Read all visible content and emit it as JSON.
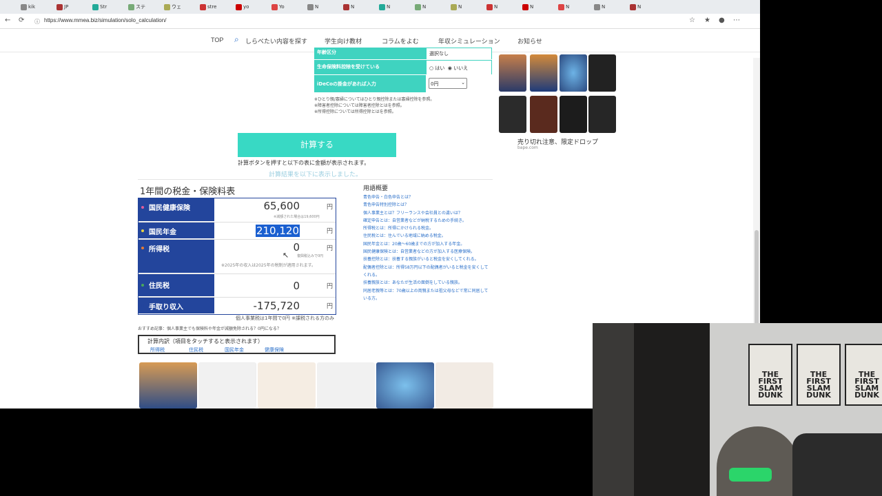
{
  "browser": {
    "url": "https://www.mmea.biz/simulation/solo_calculation/",
    "tabs": [
      "kik",
      "JP",
      "Str",
      "ステ",
      "ウェ",
      "stre",
      "yo",
      "Yo",
      "N",
      "N",
      "N",
      "N",
      "N",
      "N",
      "N",
      "N",
      "N",
      "N"
    ]
  },
  "site_nav": {
    "items": [
      "TOP",
      "しらべたい内容を探す",
      "学生向け教材",
      "コラムをよむ",
      "年収シミュレーション",
      "お知らせ"
    ]
  },
  "form": {
    "partial_row_label": "年齢区分",
    "partial_row_value": "選択なし",
    "life_insurance_label": "生命保険料控除を受けている",
    "radio_yes": "はい",
    "radio_no": "いいえ",
    "ideco_label": "iDeCoの掛金があれば入力",
    "ideco_value": "0円",
    "notes": [
      "※ひとり親/寡婦についてはひとり親控除または寡婦控除を参照。",
      "※障害者控除については障害者控除とはを参照。",
      "※所得控除については所得控除とはを参照。"
    ]
  },
  "calc": {
    "button_label": "計算する",
    "note": "計算ボタンを押すと以下の表に金額が表示されます。",
    "result_note": "計算結果を以下に表示しました。"
  },
  "results": {
    "heading": "1年間の税金・保険料表",
    "yen": "円",
    "rows": [
      {
        "label": "国民健康保険",
        "value": "65,600",
        "sub": "※減額された場合は19,600円"
      },
      {
        "label": "国民年金",
        "value": "210,120"
      },
      {
        "label": "所得税",
        "value": "0",
        "sub": "復興税込みで0円",
        "sub2": "※2025年の収入は2025年の税制が適用されます。"
      },
      {
        "label": "住民税",
        "value": "0"
      },
      {
        "label": "手取り収入",
        "value": "-175,720"
      }
    ],
    "below": "個人事業税は1年間で0円 ※課税される方のみ",
    "recommend": "おすすめ記事：個人事業主でも保険料や年金が減額免除される？0円になる？"
  },
  "breakdown": {
    "title": "計算内訳（項目をタッチすると表示されます）",
    "links": [
      "所得税",
      "住民税",
      "国民年金",
      "健康保険"
    ]
  },
  "glossary": {
    "title": "用語概要",
    "items": [
      "青色申告・白色申告とは？",
      "青色申告特別控除とは？",
      "個人事業主とは？フリーランスや会社員との違いは？",
      "確定申告とは：自営業者などが納税するための手続き。",
      "所得税とは：所得にかけられる税金。",
      "住民税とは：住んでいる地域に納める税金。",
      "国民年金とは：20歳〜60歳までの方が加入する年金。",
      "国民健康保険とは：自営業者などの方が加入する医療保険。",
      "扶養控除とは：扶養する親族がいると税金を安くしてくれる。",
      "配偶者控除とは：所得58万円以下の配偶者がいると税金を安くしてくれる。",
      "扶養親族とは：あなたが生活の面倒をしている親族。",
      "同居老親等とは：70歳以上の両親または祖父母などで常に同居している方。"
    ]
  },
  "ad": {
    "title": "売り切れ注意、限定ドロップ",
    "domain": "bape.com"
  },
  "webcam": {
    "poster_text": [
      "THE FIRST SLAM DUNK",
      "THE FIRST SLAM DUNK",
      "THE FIRST SLAM DUNK"
    ]
  }
}
